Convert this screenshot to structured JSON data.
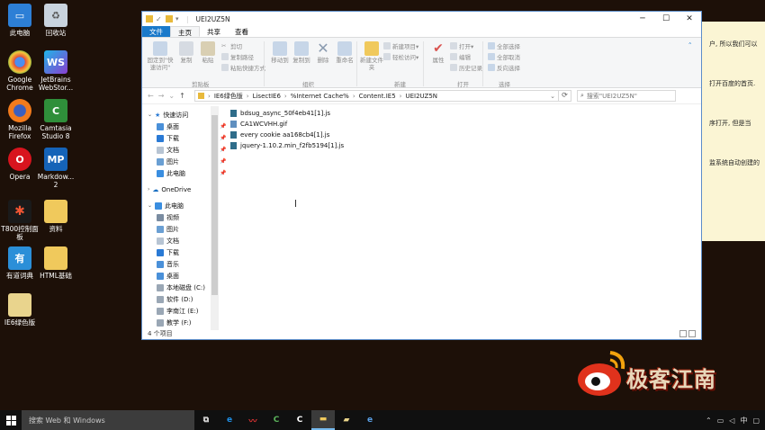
{
  "desktop": {
    "icons": [
      {
        "label": "此电脑"
      },
      {
        "label": "回收站"
      },
      {
        "label": "Google Chrome"
      },
      {
        "label": "JetBrains WebStor..."
      },
      {
        "label": "Mozilla Firefox"
      },
      {
        "label": "Camtasia Studio 8"
      },
      {
        "label": "Opera"
      },
      {
        "label": "Markdow... 2"
      },
      {
        "label": "T800控制面板"
      },
      {
        "label": "资料"
      },
      {
        "label": "有道词典"
      },
      {
        "label": "HTML基础"
      },
      {
        "label": "IE6绿色版"
      }
    ],
    "doc_lines": [
      "户, 所以我们可以",
      "打开百度的首页.",
      "序打开, 但是当",
      "监系统自动创建的"
    ]
  },
  "window": {
    "title": "UEI2UZ5N",
    "controls": {
      "minimize": "─",
      "maximize": "☐",
      "close": "✕"
    },
    "tabs": {
      "file": "文件",
      "home": "主页",
      "share": "共享",
      "view": "查看"
    },
    "ribbon": {
      "pin_quick": "固定到\"快速访问\"",
      "copy": "复制",
      "paste": "粘贴",
      "cut": "剪切",
      "copy_path": "复制路径",
      "paste_shortcut": "粘贴快捷方式",
      "move_to": "移动到",
      "copy_to": "复制到",
      "delete": "删除",
      "rename": "重命名",
      "new_folder": "新建文件夹",
      "new_item": "新建项目▾",
      "easy_access": "轻松访问▾",
      "properties": "属性",
      "open": "打开▾",
      "edit": "编辑",
      "history": "历史记录",
      "select_all": "全部选择",
      "select_none": "全部取消",
      "invert_selection": "反向选择",
      "groups": {
        "clipboard": "剪贴板",
        "organize": "组织",
        "new": "新建",
        "open": "打开",
        "select": "选择"
      }
    },
    "address": {
      "segments": [
        "IE6绿色版",
        "LisectIE6",
        "%Internet Cache%",
        "Content.IE5",
        "UEI2UZ5N"
      ],
      "search_placeholder": "搜索\"UEI2UZ5N\""
    },
    "nav": {
      "quick_access": "快速访问",
      "items": [
        "桌面",
        "下载",
        "文档",
        "图片",
        "此电脑"
      ],
      "onedrive": "OneDrive",
      "this_pc": "此电脑",
      "pc_items": [
        "视频",
        "图片",
        "文档",
        "下载",
        "音乐",
        "桌面",
        "本地磁盘 (C:)",
        "软件 (D:)",
        "李南江 (E:)",
        "教学 (F:)"
      ]
    },
    "files": [
      "bdsug_async_50f4eb41[1].js",
      "CA1WCVHH.gif",
      "every cookie aa168cb4[1].js",
      "jquery-1.10.2.min_f2fb5194[1].js"
    ],
    "status": "4 个项目"
  },
  "logo_text": "极客江南",
  "taskbar": {
    "search_placeholder": "搜索 Web 和 Windows",
    "ime": "中",
    "notifications": "▢"
  }
}
